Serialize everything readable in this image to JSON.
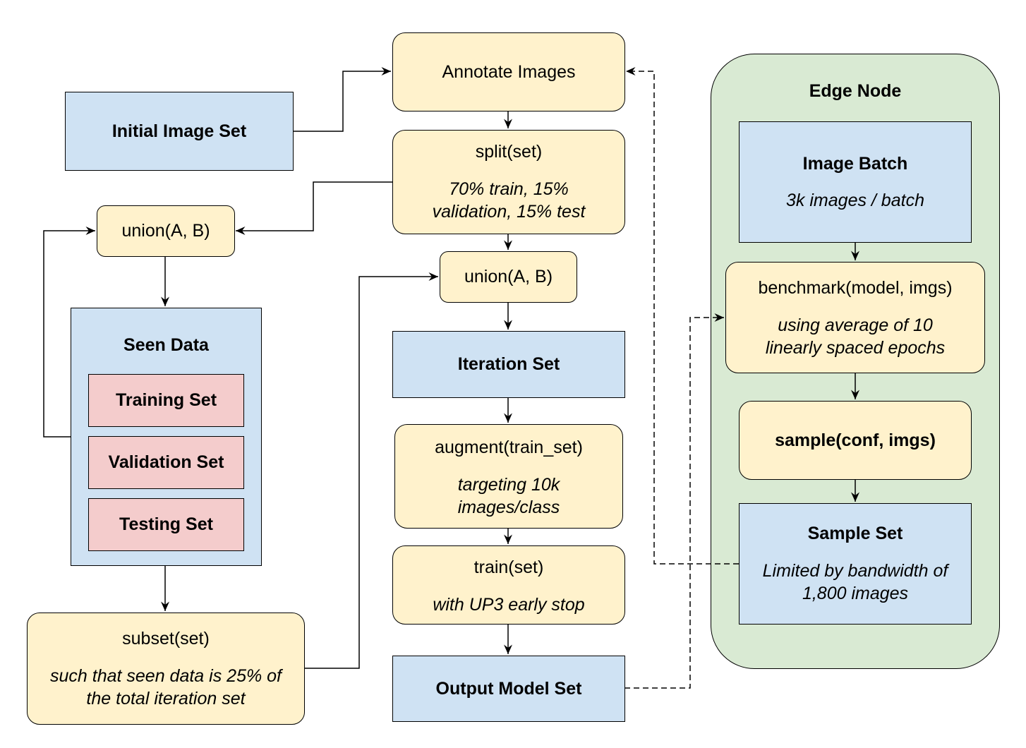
{
  "colors": {
    "process": "#fff2cc",
    "data": "#cfe2f3",
    "subset": "#f4cccc",
    "edge_node": "#d9ead3"
  },
  "nodes": {
    "initial_image_set": "Initial Image Set",
    "annotate_images": "Annotate Images",
    "split": {
      "title": "split(set)",
      "note": "70% train, 15% validation, 15% test"
    },
    "union_left": "union(A, B)",
    "union_mid": "union(A, B)",
    "seen_data": {
      "title": "Seen Data",
      "training": "Training Set",
      "validation": "Validation Set",
      "testing": "Testing Set"
    },
    "subset": {
      "title": "subset(set)",
      "note": "such that seen data is 25% of the total iteration set"
    },
    "iteration_set": "Iteration Set",
    "augment": {
      "title": "augment(train_set)",
      "note": "targeting 10k images/class"
    },
    "train": {
      "title": "train(set)",
      "note": "with UP3 early stop"
    },
    "output_model_set": "Output Model Set",
    "edge_node": {
      "title": "Edge Node",
      "image_batch": {
        "title": "Image Batch",
        "note": "3k images / batch"
      },
      "benchmark": {
        "title": "benchmark(model, imgs)",
        "note": "using average of 10 linearly spaced epochs"
      },
      "sample": "sample(conf, imgs)",
      "sample_set": {
        "title": "Sample Set",
        "note": "Limited by bandwidth of 1,800 images"
      }
    }
  }
}
